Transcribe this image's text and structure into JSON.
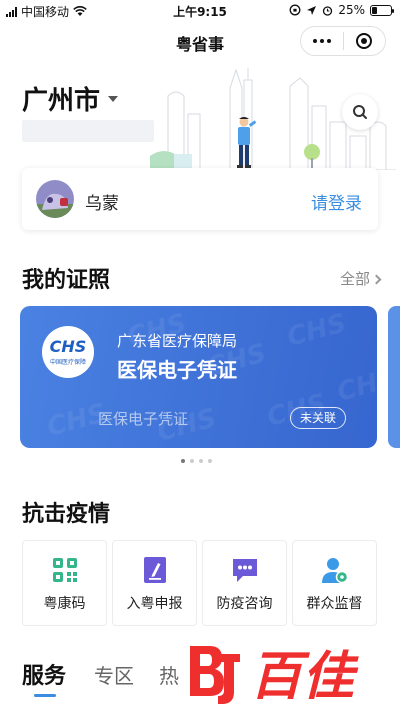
{
  "status_bar": {
    "carrier": "中国移动",
    "time": "上午9:15",
    "battery": "25%"
  },
  "nav": {
    "title": "粤省事"
  },
  "header": {
    "city": "广州市"
  },
  "user": {
    "name": "乌蒙",
    "login_label": "请登录"
  },
  "licenses": {
    "title": "我的证照",
    "all_label": "全部",
    "card": {
      "org": "广东省医疗保障局",
      "name": "医保电子凭证",
      "type": "医保电子凭证",
      "status": "未关联",
      "logo_text": "CHS",
      "logo_sub": "中国医疗保障"
    }
  },
  "epidemic": {
    "title": "抗击疫情",
    "items": [
      {
        "label": "粤康码",
        "icon": "qr-code-icon"
      },
      {
        "label": "入粤申报",
        "icon": "edit-form-icon"
      },
      {
        "label": "防疫咨询",
        "icon": "chat-bubble-icon"
      },
      {
        "label": "群众监督",
        "icon": "user-eye-icon"
      }
    ]
  },
  "tabs": [
    {
      "label": "服务",
      "active": true
    },
    {
      "label": "专区",
      "active": false
    },
    {
      "label": "热",
      "active": false
    }
  ],
  "watermark_text": "百佳",
  "colors": {
    "accent": "#3a8de0",
    "card_blue": "#4278da",
    "green": "#34b58a",
    "purple": "#6b5ad8"
  }
}
